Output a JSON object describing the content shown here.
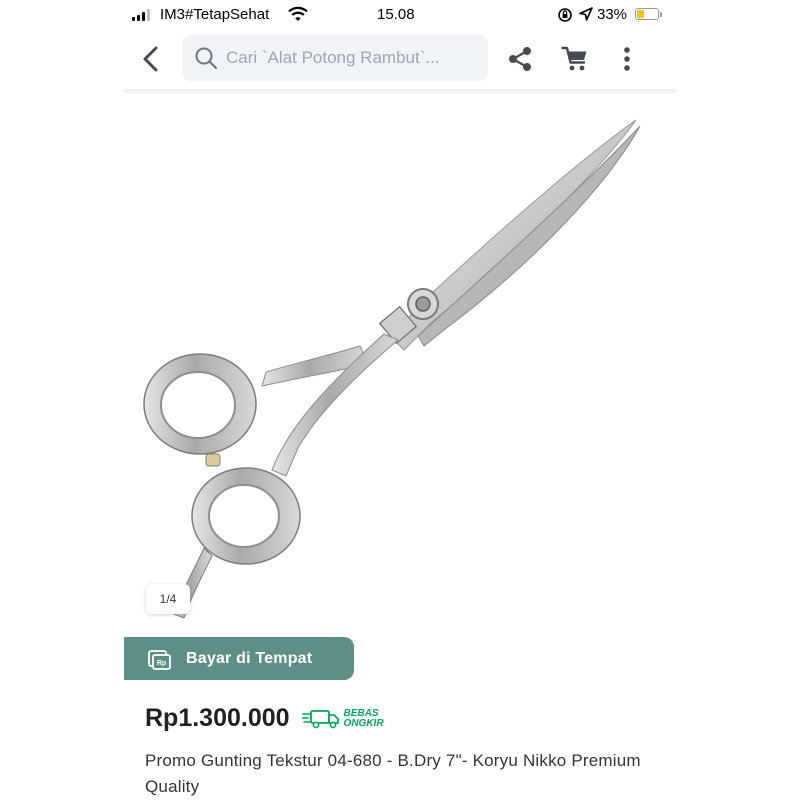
{
  "status_bar": {
    "carrier": "IM3#TetapSehat",
    "time": "15.08",
    "battery_percent": "33%",
    "battery_level": 0.33,
    "icons": [
      "signal-icon",
      "wifi-icon",
      "rotation-lock-icon",
      "location-icon",
      "battery-icon"
    ]
  },
  "navbar": {
    "search_placeholder": "Cari `Alat Potong Rambut`...",
    "icons": [
      "back-arrow-icon",
      "search-icon",
      "share-icon",
      "cart-icon",
      "more-vertical-icon"
    ]
  },
  "gallery": {
    "counter": "1/4",
    "image": "hair-scissors-photo"
  },
  "cod_banner": {
    "label": "Bayar di Tempat",
    "icon": "cash-payment-icon",
    "color": "#5d8f86"
  },
  "product": {
    "price": "Rp1.300.000",
    "free_shipping_line1": "BEBAS",
    "free_shipping_line2": "ONGKIR",
    "free_shipping_color": "#00aa5b",
    "title": "Promo Gunting Tekstur 04-680 - B.Dry 7\"- Koryu Nikko Premium Quality"
  }
}
